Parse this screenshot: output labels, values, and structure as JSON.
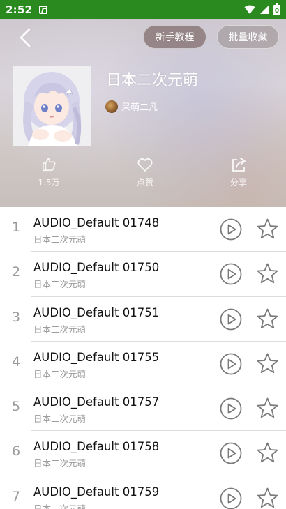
{
  "status_bar": {
    "time": "2:52",
    "battery_value": "0"
  },
  "header": {
    "tutorial_button": "新手教程",
    "batch_favorite_button": "批量收藏",
    "playlist_title": "日本二次元萌",
    "author_name": "呆萌二凡",
    "stats": {
      "likes": "1.5万",
      "favorite_label": "点赞",
      "share_label": "分享"
    }
  },
  "tracks": [
    {
      "index": "1",
      "name": "AUDIO_Default 01748",
      "album": "日本二次元萌"
    },
    {
      "index": "2",
      "name": "AUDIO_Default 01750",
      "album": "日本二次元萌"
    },
    {
      "index": "3",
      "name": "AUDIO_Default 01751",
      "album": "日本二次元萌"
    },
    {
      "index": "4",
      "name": "AUDIO_Default 01755",
      "album": "日本二次元萌"
    },
    {
      "index": "5",
      "name": "AUDIO_Default 01757",
      "album": "日本二次元萌"
    },
    {
      "index": "6",
      "name": "AUDIO_Default 01758",
      "album": "日本二次元萌"
    },
    {
      "index": "7",
      "name": "AUDIO_Default 01759",
      "album": "日本二次元萌"
    }
  ],
  "colors": {
    "status_bar": "#2a8a1f",
    "icon_gray": "#7a7a7a"
  }
}
